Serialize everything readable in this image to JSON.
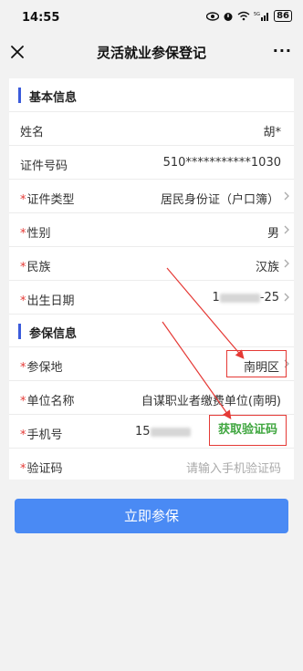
{
  "status_bar": {
    "time": "14:55",
    "battery": "86",
    "icons": [
      "eye-icon",
      "alarm-icon",
      "wifi-icon",
      "signal-5g-icon",
      "battery-icon"
    ]
  },
  "nav": {
    "title": "灵活就业参保登记",
    "close_icon": "close-icon",
    "more_label": "···"
  },
  "basic_section": {
    "title": "基本信息",
    "rows": [
      {
        "label": "姓名",
        "value": "胡*",
        "required": false
      },
      {
        "label": "证件号码",
        "value": "510***********1030",
        "required": false
      },
      {
        "label": "证件类型",
        "value": "居民身份证（户口簿）",
        "required": true
      },
      {
        "label": "性别",
        "value": "男",
        "required": true
      },
      {
        "label": "民族",
        "value": "汉族",
        "required": true
      },
      {
        "label": "出生日期",
        "value_prefix": "1",
        "value_suffix": "-25",
        "required": true
      }
    ]
  },
  "insurance_section": {
    "title": "参保信息",
    "rows": [
      {
        "label": "参保地",
        "value": "南明区",
        "required": true
      },
      {
        "label": "单位名称",
        "value": "自谋职业者缴费单位(南明)",
        "required": true
      },
      {
        "label": "手机号",
        "value_prefix": "15",
        "required": true
      },
      {
        "label": "验证码",
        "placeholder": "请输入手机验证码",
        "required": true
      }
    ],
    "get_code_label": "获取验证码"
  },
  "submit_label": "立即参保",
  "colors": {
    "accent_blue": "#4a8af4",
    "section_bar": "#3b5bdb",
    "required_red": "#e53935",
    "annotation_red": "#e53935",
    "code_green": "#3fa63f"
  }
}
